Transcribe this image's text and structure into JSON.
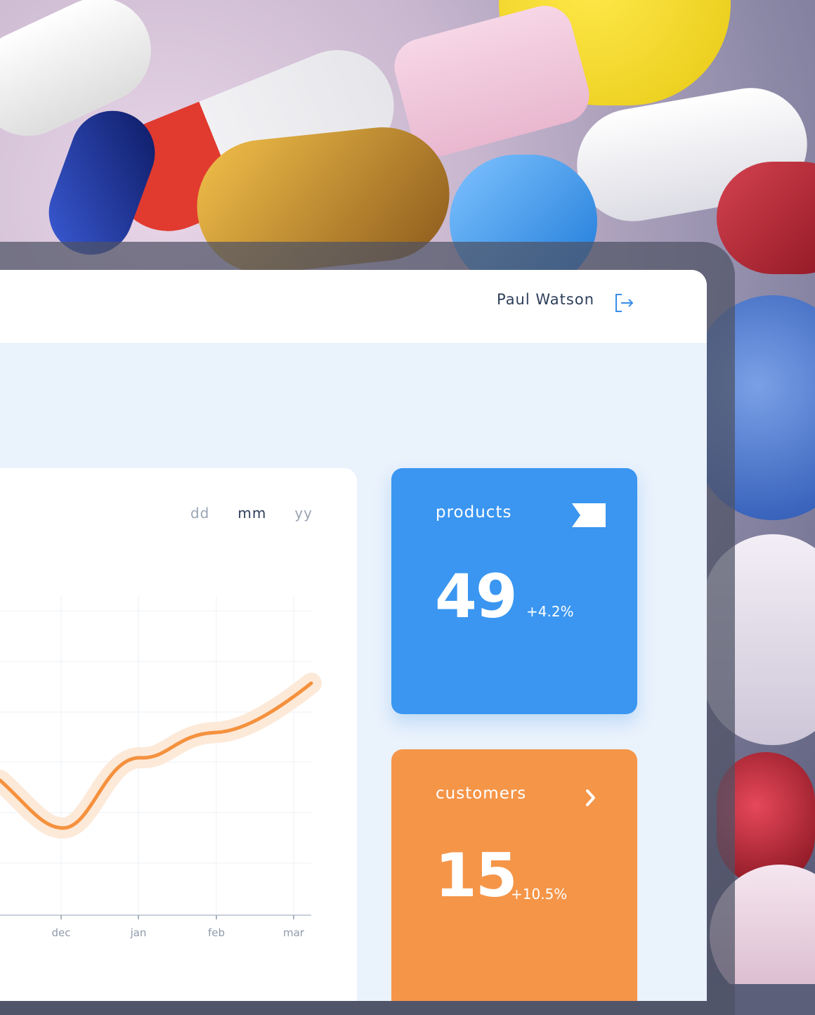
{
  "header": {
    "user_name": "Paul Watson",
    "logout_icon": "logout-icon"
  },
  "period_tabs": [
    {
      "label": "dd",
      "active": false
    },
    {
      "label": "mm",
      "active": true
    },
    {
      "label": "yy",
      "active": false
    }
  ],
  "cards": {
    "products": {
      "title": "products",
      "value": "49",
      "change": "+4.2%",
      "icon": "flag-icon",
      "color": "#3a96f0"
    },
    "customers": {
      "title": "customers",
      "value": "15",
      "change": "+10.5%",
      "icon": "chevron-right-icon",
      "color": "#f59548"
    }
  },
  "chart_data": {
    "type": "line",
    "x": [
      "dec",
      "jan",
      "feb",
      "mar"
    ],
    "grid": true,
    "series_color": "#f5913e"
  }
}
